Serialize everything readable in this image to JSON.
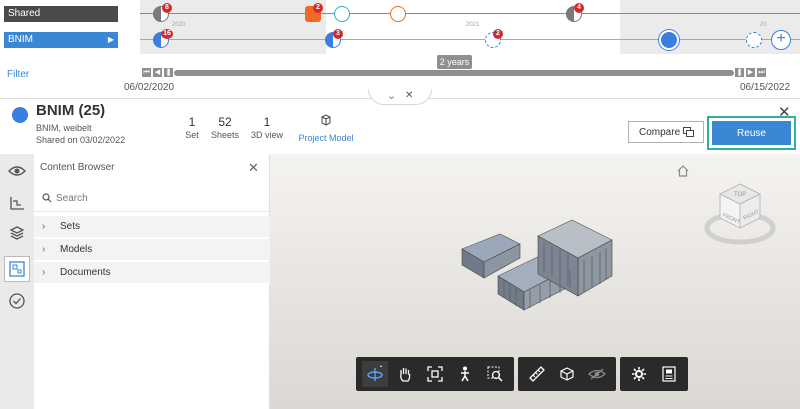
{
  "timeline": {
    "lanes": {
      "shared": "Shared",
      "bnim": "BNIM",
      "bnim_arrow": "▶"
    },
    "filter_label": "Filter",
    "years": [
      "2020",
      "2021",
      "20"
    ],
    "badges": [
      "8",
      "2",
      "4",
      "16",
      "3",
      "2"
    ],
    "range_label": "2 years",
    "start_date": "06/02/2020",
    "end_date": "06/15/2022",
    "colors": {
      "shared_lane": "#4a4a4a",
      "bnim_lane": "#3a87d6",
      "badge": "#d42a2a",
      "orange": "#f06a26",
      "teal": "#2eb0c4"
    }
  },
  "header": {
    "title": "BNIM (25)",
    "subtitle1": "BNIM, weibelt",
    "subtitle2": "Shared on 03/02/2022",
    "stats": [
      {
        "num": "1",
        "label": "Set"
      },
      {
        "num": "52",
        "label": "Sheets"
      },
      {
        "num": "1",
        "label": "3D view"
      }
    ],
    "project_model_label": "Project Model",
    "compare_label": "Compare",
    "reuse_label": "Reuse"
  },
  "browser": {
    "title": "Content Browser",
    "search_placeholder": "Search",
    "items": [
      "Sets",
      "Models",
      "Documents"
    ]
  },
  "viewer": {
    "viewcube_faces": {
      "top": "TOP",
      "front": "FRONT",
      "right": "RIGHT"
    }
  }
}
